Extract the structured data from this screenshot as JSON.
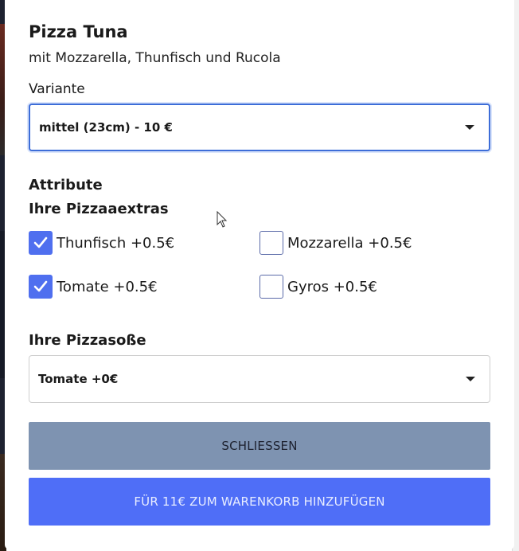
{
  "product": {
    "name": "Pizza Tuna",
    "description": "mit Mozzarella, Thunfisch und Rucola"
  },
  "variant": {
    "label": "Variante",
    "selected": "mittel (23cm) - 10 €"
  },
  "attributes": {
    "heading": "Attribute",
    "extras": {
      "heading": "Ihre Pizzaaextras",
      "options": [
        {
          "label": "Thunfisch +0.5€",
          "checked": true
        },
        {
          "label": "Mozzarella +0.5€",
          "checked": false
        },
        {
          "label": "Tomate +0.5€",
          "checked": true
        },
        {
          "label": "Gyros +0.5€",
          "checked": false
        }
      ]
    },
    "sauce": {
      "heading": "Ihre Pizzasoße",
      "selected": "Tomate +0€"
    }
  },
  "actions": {
    "close_label": "SCHLIESSEN",
    "add_label": "FÜR 11€ ZUM WARENKORB HINZUFÜGEN"
  },
  "colors": {
    "accent": "#4f6ef7",
    "checkbox_checked": "#4f6fef",
    "close_button": "#7e93b1",
    "focus_border": "#3d6dd8"
  }
}
